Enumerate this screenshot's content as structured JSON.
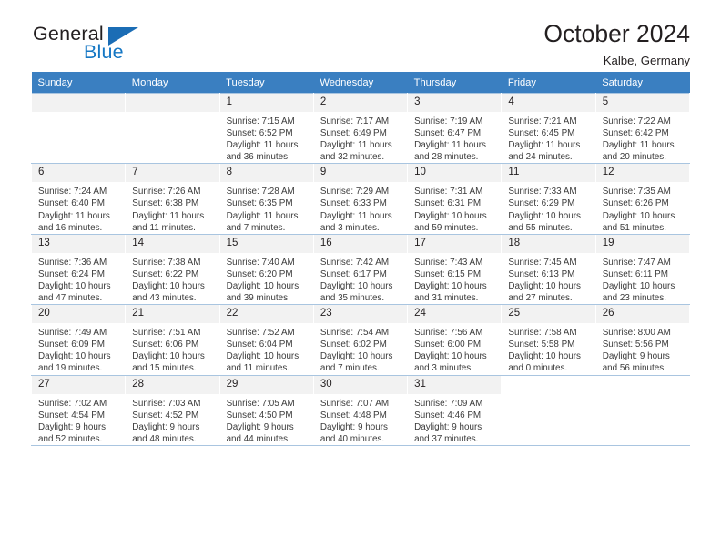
{
  "brand": {
    "word1": "General",
    "word2": "Blue",
    "accent_color": "#1577c4",
    "triangle_color": "#1b6db5"
  },
  "header": {
    "title": "October 2024",
    "subtitle": "Kalbe, Germany"
  },
  "calendar": {
    "header_bg": "#3a7fc1",
    "daynum_bg": "#f2f2f2",
    "grid_color": "#a9c5e0",
    "weekdays": [
      "Sunday",
      "Monday",
      "Tuesday",
      "Wednesday",
      "Thursday",
      "Friday",
      "Saturday"
    ],
    "weeks": [
      [
        {
          "day": "",
          "sunrise": "",
          "sunset": "",
          "daylight1": "",
          "daylight2": "",
          "blank": true
        },
        {
          "day": "",
          "sunrise": "",
          "sunset": "",
          "daylight1": "",
          "daylight2": "",
          "blank": true
        },
        {
          "day": "1",
          "sunrise": "Sunrise: 7:15 AM",
          "sunset": "Sunset: 6:52 PM",
          "daylight1": "Daylight: 11 hours",
          "daylight2": "and 36 minutes."
        },
        {
          "day": "2",
          "sunrise": "Sunrise: 7:17 AM",
          "sunset": "Sunset: 6:49 PM",
          "daylight1": "Daylight: 11 hours",
          "daylight2": "and 32 minutes."
        },
        {
          "day": "3",
          "sunrise": "Sunrise: 7:19 AM",
          "sunset": "Sunset: 6:47 PM",
          "daylight1": "Daylight: 11 hours",
          "daylight2": "and 28 minutes."
        },
        {
          "day": "4",
          "sunrise": "Sunrise: 7:21 AM",
          "sunset": "Sunset: 6:45 PM",
          "daylight1": "Daylight: 11 hours",
          "daylight2": "and 24 minutes."
        },
        {
          "day": "5",
          "sunrise": "Sunrise: 7:22 AM",
          "sunset": "Sunset: 6:42 PM",
          "daylight1": "Daylight: 11 hours",
          "daylight2": "and 20 minutes."
        }
      ],
      [
        {
          "day": "6",
          "sunrise": "Sunrise: 7:24 AM",
          "sunset": "Sunset: 6:40 PM",
          "daylight1": "Daylight: 11 hours",
          "daylight2": "and 16 minutes."
        },
        {
          "day": "7",
          "sunrise": "Sunrise: 7:26 AM",
          "sunset": "Sunset: 6:38 PM",
          "daylight1": "Daylight: 11 hours",
          "daylight2": "and 11 minutes."
        },
        {
          "day": "8",
          "sunrise": "Sunrise: 7:28 AM",
          "sunset": "Sunset: 6:35 PM",
          "daylight1": "Daylight: 11 hours",
          "daylight2": "and 7 minutes."
        },
        {
          "day": "9",
          "sunrise": "Sunrise: 7:29 AM",
          "sunset": "Sunset: 6:33 PM",
          "daylight1": "Daylight: 11 hours",
          "daylight2": "and 3 minutes."
        },
        {
          "day": "10",
          "sunrise": "Sunrise: 7:31 AM",
          "sunset": "Sunset: 6:31 PM",
          "daylight1": "Daylight: 10 hours",
          "daylight2": "and 59 minutes."
        },
        {
          "day": "11",
          "sunrise": "Sunrise: 7:33 AM",
          "sunset": "Sunset: 6:29 PM",
          "daylight1": "Daylight: 10 hours",
          "daylight2": "and 55 minutes."
        },
        {
          "day": "12",
          "sunrise": "Sunrise: 7:35 AM",
          "sunset": "Sunset: 6:26 PM",
          "daylight1": "Daylight: 10 hours",
          "daylight2": "and 51 minutes."
        }
      ],
      [
        {
          "day": "13",
          "sunrise": "Sunrise: 7:36 AM",
          "sunset": "Sunset: 6:24 PM",
          "daylight1": "Daylight: 10 hours",
          "daylight2": "and 47 minutes."
        },
        {
          "day": "14",
          "sunrise": "Sunrise: 7:38 AM",
          "sunset": "Sunset: 6:22 PM",
          "daylight1": "Daylight: 10 hours",
          "daylight2": "and 43 minutes."
        },
        {
          "day": "15",
          "sunrise": "Sunrise: 7:40 AM",
          "sunset": "Sunset: 6:20 PM",
          "daylight1": "Daylight: 10 hours",
          "daylight2": "and 39 minutes."
        },
        {
          "day": "16",
          "sunrise": "Sunrise: 7:42 AM",
          "sunset": "Sunset: 6:17 PM",
          "daylight1": "Daylight: 10 hours",
          "daylight2": "and 35 minutes."
        },
        {
          "day": "17",
          "sunrise": "Sunrise: 7:43 AM",
          "sunset": "Sunset: 6:15 PM",
          "daylight1": "Daylight: 10 hours",
          "daylight2": "and 31 minutes."
        },
        {
          "day": "18",
          "sunrise": "Sunrise: 7:45 AM",
          "sunset": "Sunset: 6:13 PM",
          "daylight1": "Daylight: 10 hours",
          "daylight2": "and 27 minutes."
        },
        {
          "day": "19",
          "sunrise": "Sunrise: 7:47 AM",
          "sunset": "Sunset: 6:11 PM",
          "daylight1": "Daylight: 10 hours",
          "daylight2": "and 23 minutes."
        }
      ],
      [
        {
          "day": "20",
          "sunrise": "Sunrise: 7:49 AM",
          "sunset": "Sunset: 6:09 PM",
          "daylight1": "Daylight: 10 hours",
          "daylight2": "and 19 minutes."
        },
        {
          "day": "21",
          "sunrise": "Sunrise: 7:51 AM",
          "sunset": "Sunset: 6:06 PM",
          "daylight1": "Daylight: 10 hours",
          "daylight2": "and 15 minutes."
        },
        {
          "day": "22",
          "sunrise": "Sunrise: 7:52 AM",
          "sunset": "Sunset: 6:04 PM",
          "daylight1": "Daylight: 10 hours",
          "daylight2": "and 11 minutes."
        },
        {
          "day": "23",
          "sunrise": "Sunrise: 7:54 AM",
          "sunset": "Sunset: 6:02 PM",
          "daylight1": "Daylight: 10 hours",
          "daylight2": "and 7 minutes."
        },
        {
          "day": "24",
          "sunrise": "Sunrise: 7:56 AM",
          "sunset": "Sunset: 6:00 PM",
          "daylight1": "Daylight: 10 hours",
          "daylight2": "and 3 minutes."
        },
        {
          "day": "25",
          "sunrise": "Sunrise: 7:58 AM",
          "sunset": "Sunset: 5:58 PM",
          "daylight1": "Daylight: 10 hours",
          "daylight2": "and 0 minutes."
        },
        {
          "day": "26",
          "sunrise": "Sunrise: 8:00 AM",
          "sunset": "Sunset: 5:56 PM",
          "daylight1": "Daylight: 9 hours",
          "daylight2": "and 56 minutes."
        }
      ],
      [
        {
          "day": "27",
          "sunrise": "Sunrise: 7:02 AM",
          "sunset": "Sunset: 4:54 PM",
          "daylight1": "Daylight: 9 hours",
          "daylight2": "and 52 minutes."
        },
        {
          "day": "28",
          "sunrise": "Sunrise: 7:03 AM",
          "sunset": "Sunset: 4:52 PM",
          "daylight1": "Daylight: 9 hours",
          "daylight2": "and 48 minutes."
        },
        {
          "day": "29",
          "sunrise": "Sunrise: 7:05 AM",
          "sunset": "Sunset: 4:50 PM",
          "daylight1": "Daylight: 9 hours",
          "daylight2": "and 44 minutes."
        },
        {
          "day": "30",
          "sunrise": "Sunrise: 7:07 AM",
          "sunset": "Sunset: 4:48 PM",
          "daylight1": "Daylight: 9 hours",
          "daylight2": "and 40 minutes."
        },
        {
          "day": "31",
          "sunrise": "Sunrise: 7:09 AM",
          "sunset": "Sunset: 4:46 PM",
          "daylight1": "Daylight: 9 hours",
          "daylight2": "and 37 minutes."
        },
        {
          "day": "",
          "sunrise": "",
          "sunset": "",
          "daylight1": "",
          "daylight2": "",
          "nofill": true
        },
        {
          "day": "",
          "sunrise": "",
          "sunset": "",
          "daylight1": "",
          "daylight2": "",
          "nofill": true
        }
      ]
    ]
  }
}
